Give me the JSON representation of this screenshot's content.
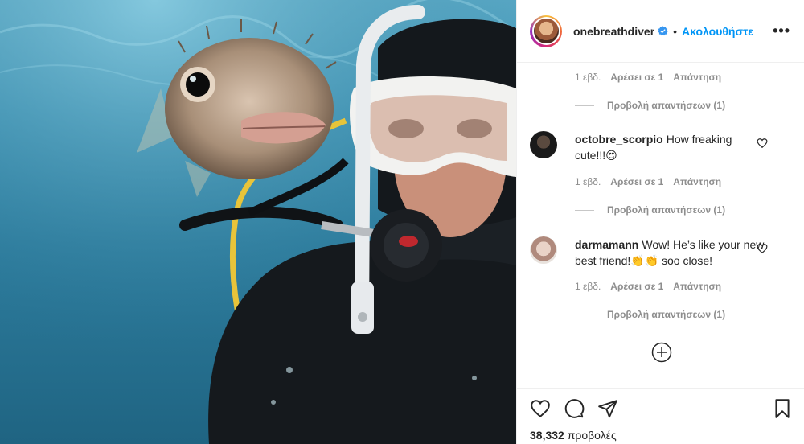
{
  "header": {
    "username": "onebreathdiver",
    "follow_label": "Ακολουθήστε",
    "separator": "•",
    "more_label": "•••"
  },
  "thread_top": {
    "meta": {
      "time": "1 εβδ.",
      "likes": "Αρέσει σε 1",
      "reply": "Απάντηση"
    },
    "view_replies": "Προβολή απαντήσεων (1)"
  },
  "comments": [
    {
      "username": "octobre_scorpio",
      "text": "How freaking cute!!!😍",
      "meta": {
        "time": "1 εβδ.",
        "likes": "Αρέσει σε 1",
        "reply": "Απάντηση"
      },
      "view_replies": "Προβολή απαντήσεων (1)"
    },
    {
      "username": "darmamann",
      "text": "Wow! He’s like your new best friend!👏👏 soo close!",
      "meta": {
        "time": "1 εβδ.",
        "likes": "Αρέσει σε 1",
        "reply": "Απάντηση"
      },
      "view_replies": "Προβολή απαντήσεων (1)"
    }
  ],
  "footer": {
    "view_count": "38,332",
    "view_label": "προβολές"
  },
  "colors": {
    "accent": "#0095f6",
    "muted": "#8e8e8e",
    "text": "#262626",
    "border": "#efefef"
  },
  "icons": [
    "verified-badge-icon",
    "more-options-icon",
    "heart-icon",
    "comment-icon",
    "share-icon",
    "bookmark-icon",
    "add-comment-icon"
  ]
}
